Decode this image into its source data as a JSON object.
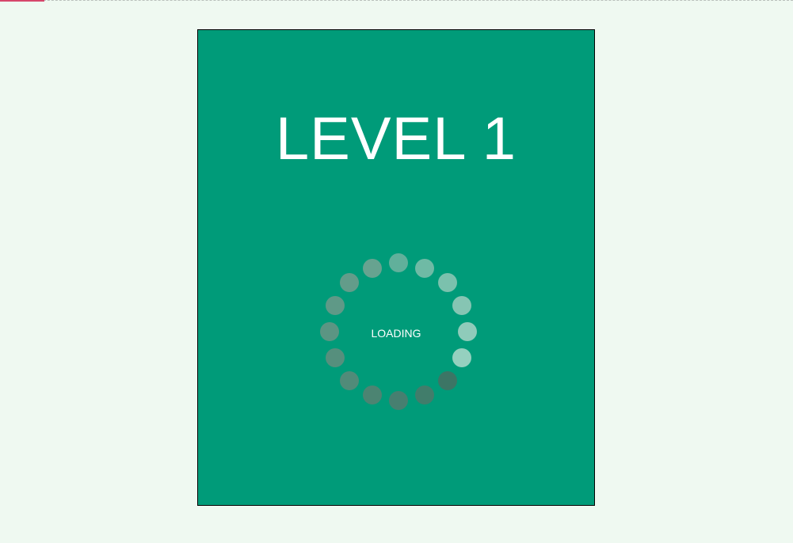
{
  "level": {
    "title": "LEVEL 1"
  },
  "loader": {
    "label": "LOADING",
    "dot_colors": [
      "#61b09b",
      "#6fbaa5",
      "#7bc1ad",
      "#86c5b3",
      "#8fcbba",
      "#95d0bf",
      "#3c7565",
      "#417d6b",
      "#477f70",
      "#4c8472",
      "#518b79",
      "#568f7d",
      "#5b9583",
      "#5f9987",
      "#639c8a",
      "#67a390"
    ]
  }
}
